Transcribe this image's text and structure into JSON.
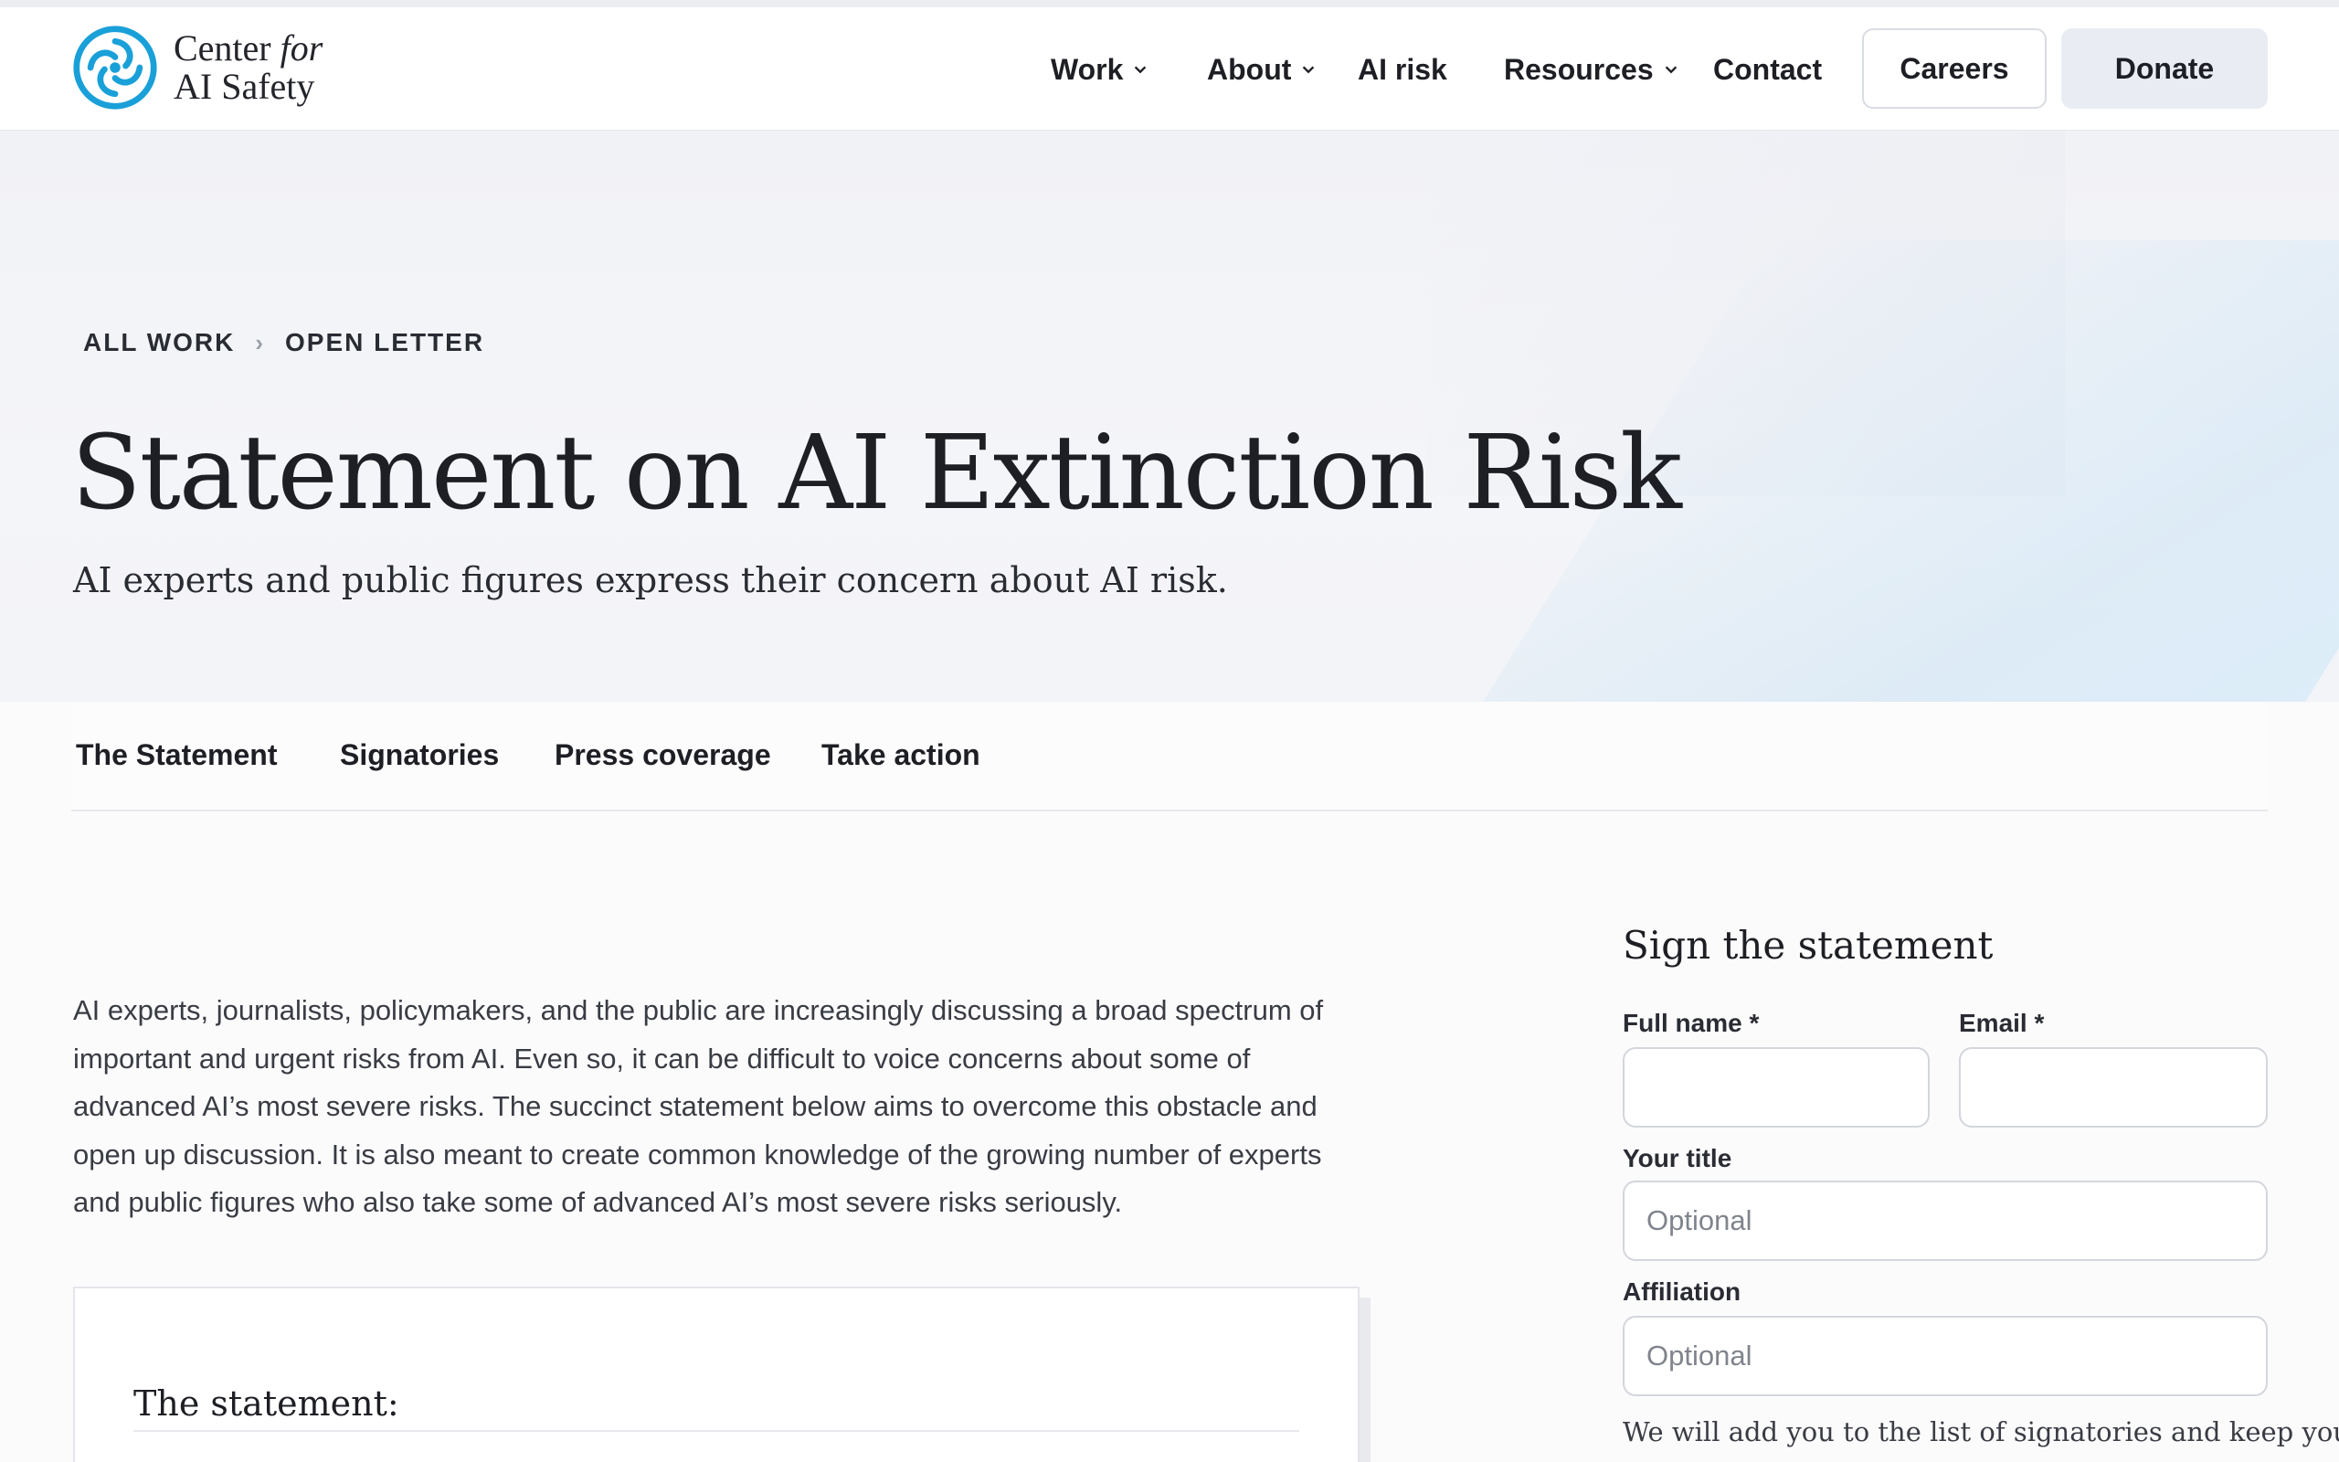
{
  "header": {
    "logo": {
      "line1_prefix": "Center",
      "line1_italic": "for",
      "line2": "AI Safety"
    },
    "nav": [
      {
        "label": "Work",
        "has_dropdown": true
      },
      {
        "label": "About",
        "has_dropdown": true
      },
      {
        "label": "AI risk",
        "has_dropdown": false
      },
      {
        "label": "Resources",
        "has_dropdown": true
      },
      {
        "label": "Contact",
        "has_dropdown": false
      }
    ],
    "careers_label": "Careers",
    "donate_label": "Donate"
  },
  "hero": {
    "breadcrumb": [
      "ALL WORK",
      "OPEN LETTER"
    ],
    "title": "Statement on AI Extinction Risk",
    "subtitle": "AI experts and public figures express their concern about AI risk."
  },
  "tabs": [
    "The Statement",
    "Signatories",
    "Press coverage",
    "Take action"
  ],
  "intro": {
    "lines": [
      "AI experts, journalists, policymakers, and the public are increasingly discussing a broad spectrum of",
      "important and urgent risks from AI. Even so, it can be difficult to voice concerns about some of",
      "advanced AI’s most severe risks. The succinct statement below aims to overcome this obstacle and",
      "open up discussion. It is also meant to create common knowledge of the growing number of experts",
      "and public figures who also take some of advanced AI’s most severe risks seriously."
    ]
  },
  "statement": {
    "label": "The statement:"
  },
  "form": {
    "title": "Sign the statement",
    "full_name_label": "Full name *",
    "email_label": "Email *",
    "title_label": "Your title",
    "title_placeholder": "Optional",
    "affiliation_label": "Affiliation",
    "affiliation_placeholder": "Optional",
    "note": "We will add you to the list of signatories and keep you"
  },
  "colors": {
    "accent_logo": "#1aa0d8",
    "text": "#1e1f24",
    "donate_bg": "#e9edf3"
  }
}
